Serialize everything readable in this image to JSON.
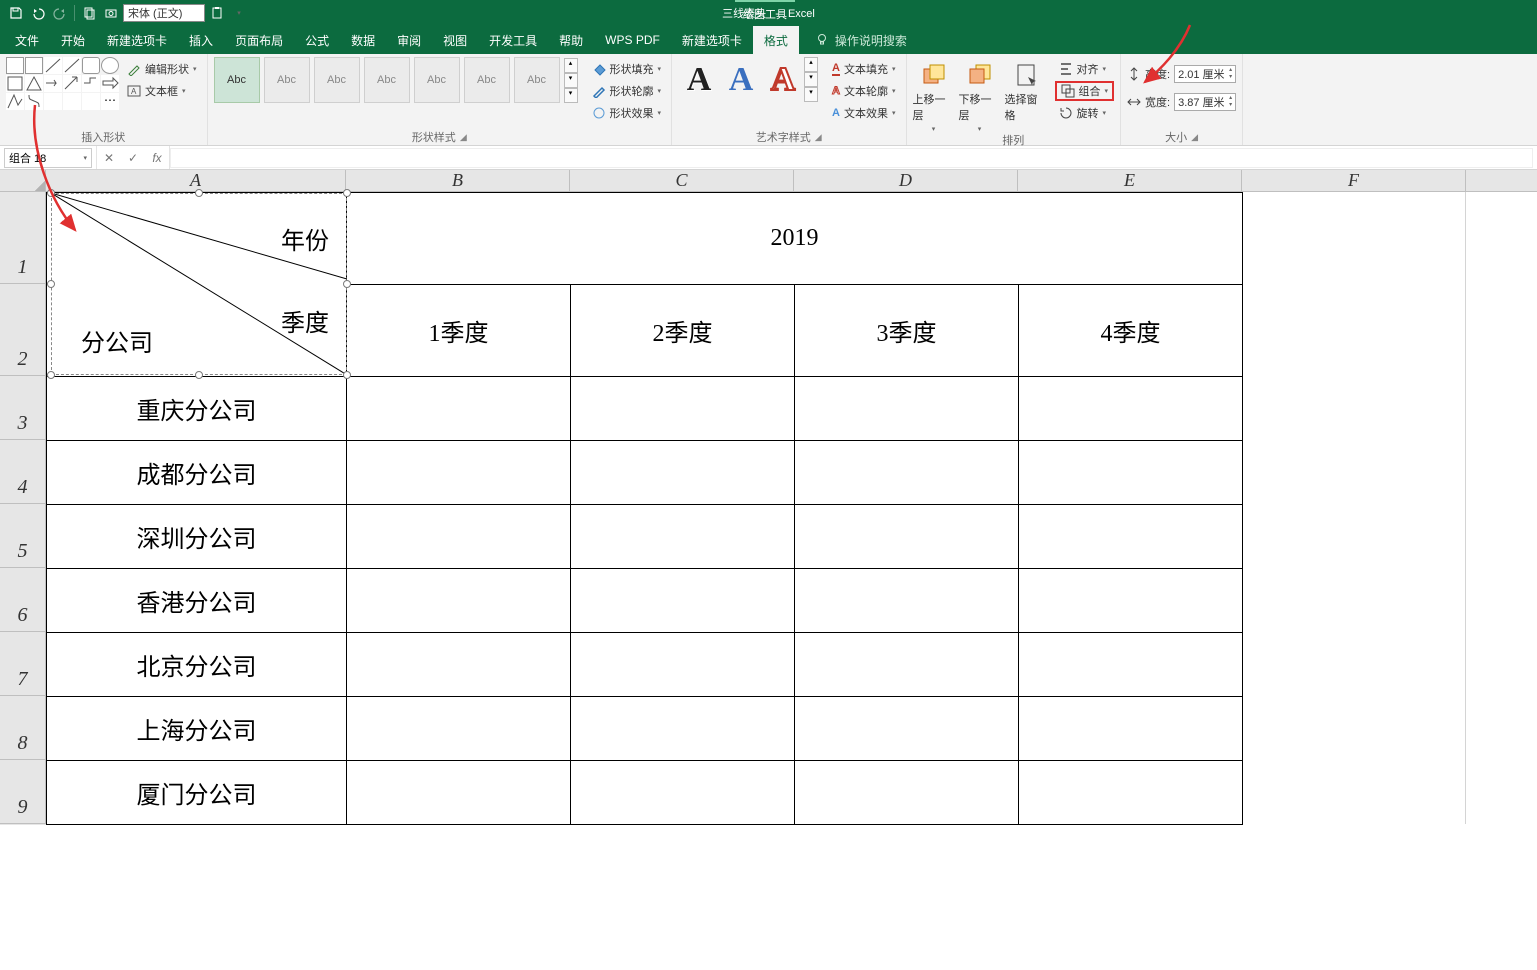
{
  "app": {
    "window_title_doc": "三线表头",
    "window_title_app": "Excel",
    "context_tool": "绘图工具"
  },
  "qat": {
    "font_name": "宋体 (正文)"
  },
  "tabs": {
    "file": "文件",
    "home": "开始",
    "new_tab": "新建选项卡",
    "insert": "插入",
    "layout": "页面布局",
    "formula": "公式",
    "data": "数据",
    "review": "审阅",
    "view": "视图",
    "dev": "开发工具",
    "help": "帮助",
    "wps": "WPS PDF",
    "new_tab2": "新建选项卡",
    "format": "格式",
    "tell_me": "操作说明搜索"
  },
  "ribbon": {
    "insert_shapes_label": "插入形状",
    "edit_shape": "编辑形状",
    "text_box": "文本框",
    "abc": "Abc",
    "shape_styles_label": "形状样式",
    "shape_fill": "形状填充",
    "shape_outline": "形状轮廓",
    "shape_effects": "形状效果",
    "wordart_styles_label": "艺术字样式",
    "text_fill": "文本填充",
    "text_outline": "文本轮廓",
    "text_effects": "文本效果",
    "bring_forward": "上移一层",
    "send_backward": "下移一层",
    "selection_pane": "选择窗格",
    "align": "对齐",
    "group": "组合",
    "rotate": "旋转",
    "arrange_label": "排列",
    "height_label": "高度:",
    "height_value": "2.01 厘米",
    "width_label": "宽度:",
    "width_value": "3.87 厘米",
    "size_label": "大小"
  },
  "formula_bar": {
    "name_box": "组合 18"
  },
  "sheet": {
    "columns": [
      "A",
      "B",
      "C",
      "D",
      "E",
      "F"
    ],
    "rows": [
      "1",
      "2",
      "3",
      "4",
      "5",
      "6",
      "7",
      "8",
      "9"
    ],
    "header_a1_diag": {
      "corner_top": "年份",
      "corner_mid": "季度",
      "corner_left": "分公司"
    },
    "year": "2019",
    "quarters": [
      "1季度",
      "2季度",
      "3季度",
      "4季度"
    ],
    "branches": [
      "重庆分公司",
      "成都分公司",
      "深圳分公司",
      "香港分公司",
      "北京分公司",
      "上海分公司",
      "厦门分公司"
    ]
  }
}
